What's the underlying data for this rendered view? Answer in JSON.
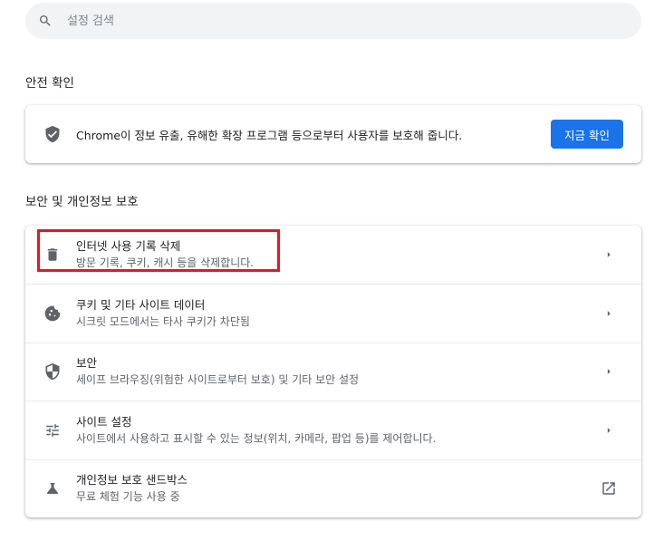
{
  "search": {
    "placeholder": "설정 검색",
    "icon": "search-icon"
  },
  "safety_check": {
    "section_title": "안전 확인",
    "description": "Chrome이 정보 유출, 유해한 확장 프로그램 등으로부터 사용자를 보호해 줍니다.",
    "button_label": "지금 확인",
    "icon": "shield-check-icon",
    "accent_color": "#1a73e8"
  },
  "privacy": {
    "section_title": "보안 및 개인정보 보호",
    "items": [
      {
        "title": "인터넷 사용 기록 삭제",
        "subtitle": "방문 기록, 쿠키, 캐시 등을 삭제합니다.",
        "icon": "trash-icon",
        "end": "chevron-right-icon"
      },
      {
        "title": "쿠키 및 기타 사이트 데이터",
        "subtitle": "시크릿 모드에서는 타사 쿠키가 차단됨",
        "icon": "cookie-icon",
        "end": "chevron-right-icon"
      },
      {
        "title": "보안",
        "subtitle": "세이프 브라우징(위험한 사이트로부터 보호) 및 기타 보안 설정",
        "icon": "security-shield-icon",
        "end": "chevron-right-icon"
      },
      {
        "title": "사이트 설정",
        "subtitle": "사이트에서 사용하고 표시할 수 있는 정보(위치, 카메라, 팝업 등)를 제어합니다.",
        "icon": "tune-icon",
        "end": "chevron-right-icon"
      },
      {
        "title": "개인정보 보호 샌드박스",
        "subtitle": "무료 체험 기능 사용 중",
        "icon": "flask-icon",
        "end": "external-link-icon"
      }
    ]
  },
  "annotation": {
    "highlight_color": "#e8161e"
  }
}
